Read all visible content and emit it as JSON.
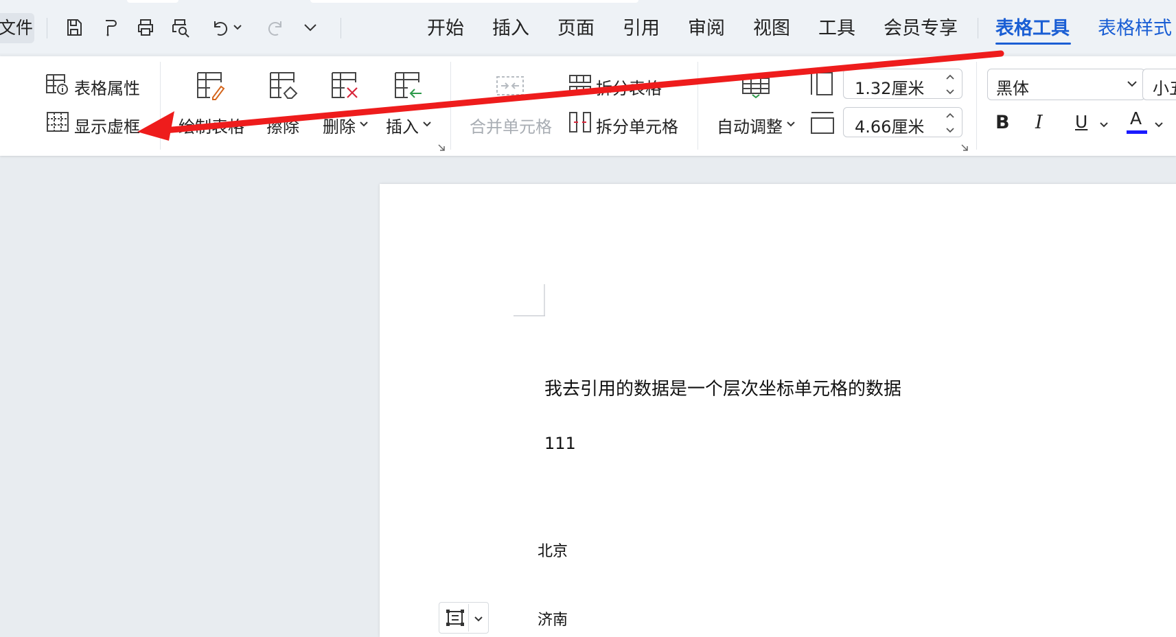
{
  "titlebar": {
    "file_label": "文件",
    "quick_access": [
      "save-icon",
      "format-painter-icon",
      "print-icon",
      "print-preview-icon",
      "undo-icon",
      "redo-icon",
      "more-icon"
    ],
    "tabs": [
      {
        "label": "开始"
      },
      {
        "label": "插入"
      },
      {
        "label": "页面"
      },
      {
        "label": "引用"
      },
      {
        "label": "审阅"
      },
      {
        "label": "视图"
      },
      {
        "label": "工具"
      },
      {
        "label": "会员专享"
      },
      {
        "label": "表格工具",
        "active": true
      },
      {
        "label": "表格样式"
      }
    ],
    "accent_color": "#1a5ed4"
  },
  "ribbon": {
    "table_properties": "表格属性",
    "show_gridlines": "显示虚框",
    "draw_table": "绘制表格",
    "erase": "擦除",
    "delete": "删除",
    "insert": "插入",
    "merge_cells": "合并单元格",
    "split_table": "拆分表格",
    "split_cells": "拆分单元格",
    "auto_fit": "自动调整",
    "row_height": "1.32厘米",
    "col_width": "4.66厘米",
    "font_name": "黑体",
    "font_size": "小五",
    "bold": "B",
    "italic": "I",
    "underline": "U",
    "font_color_letter": "A",
    "font_color": "#1a1aff"
  },
  "document": {
    "line1": "我去引用的数据是一个层次坐标单元格的数据",
    "line2": "111",
    "line3": "北京",
    "line4": "济南"
  },
  "annotation": {
    "arrow_color": "#ee1c1c"
  }
}
